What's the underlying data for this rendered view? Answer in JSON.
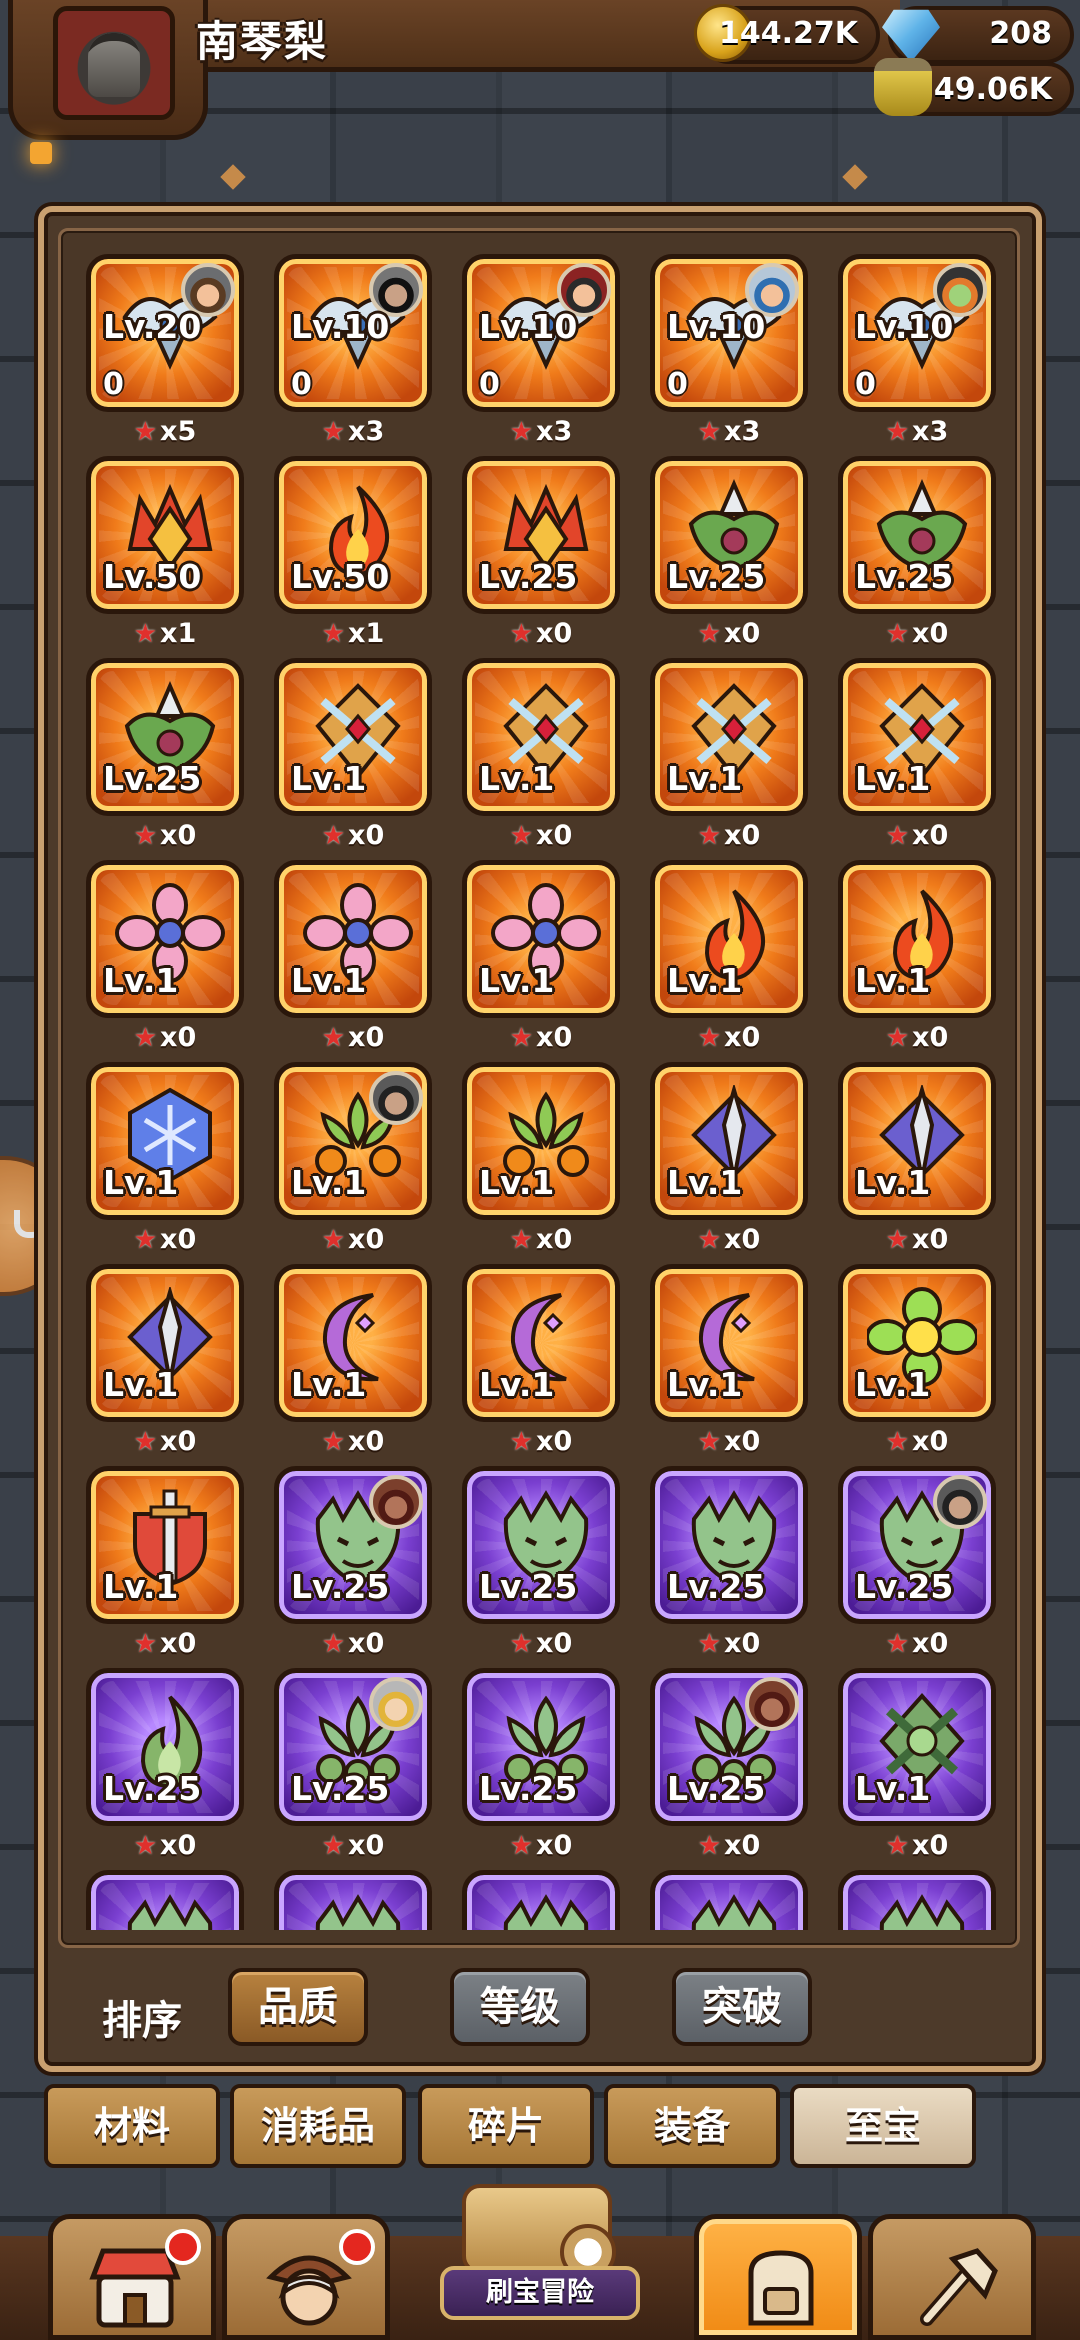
{
  "player": {
    "name": "南琴梨"
  },
  "resources": {
    "gold": "144.27K",
    "gems": "208",
    "potion": "49.06K"
  },
  "colors": {
    "panel_border": "#c9a070",
    "tile_orange": "#f07b1a",
    "tile_purple": "#7a3fd0",
    "star": "#e0302c",
    "active_nav": "#ffb347"
  },
  "items": [
    {
      "icon": "silver-wing-crest-icon",
      "rarity": "orange",
      "level": "Lv.20",
      "count": "0",
      "stars": "x5",
      "owner": "o1"
    },
    {
      "icon": "silver-wing-crest-icon",
      "rarity": "orange",
      "level": "Lv.10",
      "count": "0",
      "stars": "x3",
      "owner": "o2"
    },
    {
      "icon": "silver-wing-crest-icon",
      "rarity": "orange",
      "level": "Lv.10",
      "count": "0",
      "stars": "x3",
      "owner": "o3"
    },
    {
      "icon": "silver-wing-crest-icon",
      "rarity": "orange",
      "level": "Lv.10",
      "count": "0",
      "stars": "x3",
      "owner": "o4"
    },
    {
      "icon": "silver-wing-crest-icon",
      "rarity": "orange",
      "level": "Lv.10",
      "count": "0",
      "stars": "x3",
      "owner": "o5"
    },
    {
      "icon": "flame-crown-icon",
      "rarity": "orange",
      "level": "Lv.50",
      "stars": "x1"
    },
    {
      "icon": "fire-icon",
      "rarity": "orange",
      "level": "Lv.50",
      "stars": "x1"
    },
    {
      "icon": "flame-crown-icon",
      "rarity": "orange",
      "level": "Lv.25",
      "stars": "x0"
    },
    {
      "icon": "green-horn-icon",
      "rarity": "orange",
      "level": "Lv.25",
      "stars": "x0"
    },
    {
      "icon": "green-horn-icon",
      "rarity": "orange",
      "level": "Lv.25",
      "stars": "x0"
    },
    {
      "icon": "green-horn-icon",
      "rarity": "orange",
      "level": "Lv.25",
      "stars": "x0"
    },
    {
      "icon": "golden-cross-shield-icon",
      "rarity": "orange",
      "level": "Lv.1",
      "stars": "x0"
    },
    {
      "icon": "golden-cross-shield-icon",
      "rarity": "orange",
      "level": "Lv.1",
      "stars": "x0"
    },
    {
      "icon": "golden-cross-shield-icon",
      "rarity": "orange",
      "level": "Lv.1",
      "stars": "x0"
    },
    {
      "icon": "golden-cross-shield-icon",
      "rarity": "orange",
      "level": "Lv.1",
      "stars": "x0"
    },
    {
      "icon": "pink-flower-icon",
      "rarity": "orange",
      "level": "Lv.1",
      "stars": "x0"
    },
    {
      "icon": "pink-flower-icon",
      "rarity": "orange",
      "level": "Lv.1",
      "stars": "x0"
    },
    {
      "icon": "pink-flower-icon",
      "rarity": "orange",
      "level": "Lv.1",
      "stars": "x0"
    },
    {
      "icon": "fire-icon",
      "rarity": "orange",
      "level": "Lv.1",
      "stars": "x0"
    },
    {
      "icon": "fire-icon",
      "rarity": "orange",
      "level": "Lv.1",
      "stars": "x0"
    },
    {
      "icon": "snowflake-hexagon-icon",
      "rarity": "orange",
      "level": "Lv.1",
      "stars": "x0"
    },
    {
      "icon": "green-orb-plant-icon",
      "rarity": "orange",
      "level": "Lv.1",
      "stars": "x0",
      "owner": "o6"
    },
    {
      "icon": "green-orb-plant-icon",
      "rarity": "orange",
      "level": "Lv.1",
      "stars": "x0"
    },
    {
      "icon": "spear-diamond-icon",
      "rarity": "orange",
      "level": "Lv.1",
      "stars": "x0"
    },
    {
      "icon": "spear-diamond-icon",
      "rarity": "orange",
      "level": "Lv.1",
      "stars": "x0"
    },
    {
      "icon": "spear-diamond-icon",
      "rarity": "orange",
      "level": "Lv.1",
      "stars": "x0"
    },
    {
      "icon": "purple-moon-icon",
      "rarity": "orange",
      "level": "Lv.1",
      "stars": "x0"
    },
    {
      "icon": "purple-moon-icon",
      "rarity": "orange",
      "level": "Lv.1",
      "stars": "x0"
    },
    {
      "icon": "purple-moon-icon",
      "rarity": "orange",
      "level": "Lv.1",
      "stars": "x0"
    },
    {
      "icon": "yellow-flower-icon",
      "rarity": "orange",
      "level": "Lv.1",
      "stars": "x0"
    },
    {
      "icon": "sword-shield-icon",
      "rarity": "orange",
      "level": "Lv.1",
      "stars": "x0"
    },
    {
      "icon": "dragon-head-icon",
      "rarity": "purple",
      "level": "Lv.25",
      "stars": "x0",
      "owner": "o7"
    },
    {
      "icon": "dragon-head-icon",
      "rarity": "purple",
      "level": "Lv.25",
      "stars": "x0"
    },
    {
      "icon": "dragon-head-icon",
      "rarity": "purple",
      "level": "Lv.25",
      "stars": "x0"
    },
    {
      "icon": "dragon-head-icon",
      "rarity": "purple",
      "level": "Lv.25",
      "stars": "x0",
      "owner": "o6"
    },
    {
      "icon": "green-flame-icon",
      "rarity": "purple",
      "level": "Lv.25",
      "stars": "x0"
    },
    {
      "icon": "green-leaf-plant-icon",
      "rarity": "purple",
      "level": "Lv.25",
      "stars": "x0",
      "owner": "o8"
    },
    {
      "icon": "green-leaf-plant-icon",
      "rarity": "purple",
      "level": "Lv.25",
      "stars": "x0"
    },
    {
      "icon": "green-leaf-plant-icon",
      "rarity": "purple",
      "level": "Lv.25",
      "stars": "x0",
      "owner": "o7"
    },
    {
      "icon": "green-cross-emblem-icon",
      "rarity": "purple",
      "level": "Lv.1",
      "stars": "x0"
    },
    {
      "icon": "dragon-head-icon",
      "rarity": "purple",
      "partial": true
    },
    {
      "icon": "dragon-head-icon",
      "rarity": "purple",
      "partial": true
    },
    {
      "icon": "dragon-head-icon",
      "rarity": "purple",
      "partial": true
    },
    {
      "icon": "dragon-head-icon",
      "rarity": "purple",
      "partial": true
    },
    {
      "icon": "dragon-head-icon",
      "rarity": "purple",
      "partial": true
    }
  ],
  "sort": {
    "label": "排序",
    "options": [
      {
        "label": "品质",
        "active": true
      },
      {
        "label": "等级",
        "active": false
      },
      {
        "label": "突破",
        "active": false
      }
    ]
  },
  "categories": [
    {
      "label": "材料",
      "active": false
    },
    {
      "label": "消耗品",
      "active": false
    },
    {
      "label": "碎片",
      "active": false
    },
    {
      "label": "装备",
      "active": false
    },
    {
      "label": "至宝",
      "active": true
    }
  ],
  "bottom_nav": {
    "items": [
      {
        "name": "shop",
        "icon": "shop-icon",
        "badge": true
      },
      {
        "name": "hero",
        "icon": "hero-portrait-icon",
        "badge": true
      },
      {
        "name": "adventure",
        "icon": "treasure-map-icon",
        "label": "刷宝冒险"
      },
      {
        "name": "bag",
        "icon": "backpack-icon",
        "active": true
      },
      {
        "name": "forge",
        "icon": "hammer-icon"
      }
    ]
  }
}
